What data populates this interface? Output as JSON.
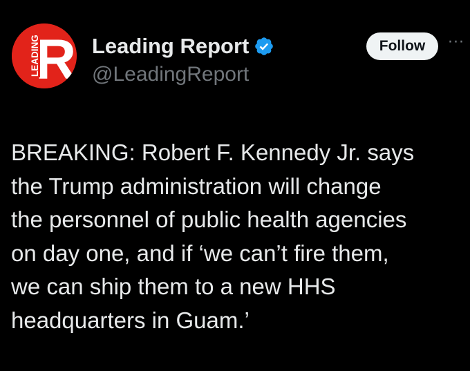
{
  "account": {
    "display_name": "Leading Report",
    "handle": "@LeadingReport",
    "verified": true,
    "avatar": {
      "icon": "leading-report-logo",
      "logo_letter": "R",
      "logo_text": "LEADING",
      "brand_color": "#e2231a"
    }
  },
  "actions": {
    "follow_label": "Follow",
    "more_icon": "more-options-icon",
    "more_glyph": "···"
  },
  "tweet": {
    "text": "BREAKING: Robert F. Kennedy Jr. says\nthe Trump administration will change\nthe personnel of public health agencies\non day one, and if ‘we can’t fire them,\nwe can ship them to a new HHS\nheadquarters in Guam.’"
  },
  "colors": {
    "background": "#000000",
    "text_primary": "#e7e9ea",
    "text_secondary": "#71767b",
    "verified_blue": "#1d9bf0",
    "follow_bg": "#eff3f4"
  }
}
